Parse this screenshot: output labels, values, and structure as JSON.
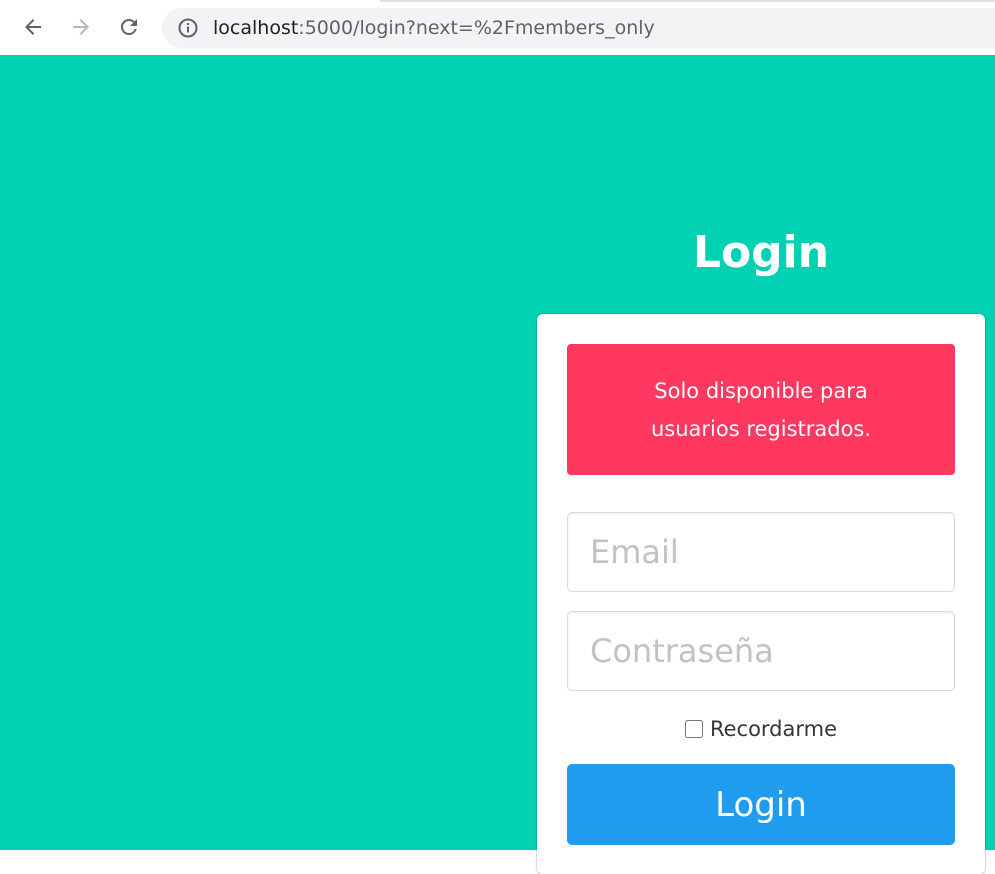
{
  "browser": {
    "url_host": "localhost",
    "url_rest": ":5000/login?next=%2Fmembers_only",
    "icons": {
      "back": "back-arrow-icon",
      "forward": "forward-arrow-icon",
      "reload": "reload-icon",
      "info": "info-icon"
    }
  },
  "page": {
    "background": "#00d1b2",
    "title": "Login"
  },
  "alert": {
    "message": "Solo disponible para usuarios registrados.",
    "color": "#ff3860"
  },
  "form": {
    "email_placeholder": "Email",
    "password_placeholder": "Contraseña",
    "remember_label": "Recordarme",
    "remember_checked": false,
    "submit_label": "Login",
    "submit_color": "#209cee"
  }
}
